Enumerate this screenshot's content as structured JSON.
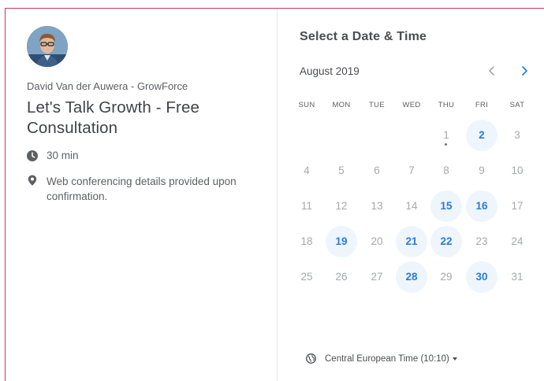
{
  "event": {
    "host": "David Van der Auwera - GrowForce",
    "title": "Let's Talk Growth - Free Consultation",
    "duration": "30 min",
    "location": "Web conferencing details provided upon confirmation."
  },
  "calendar": {
    "heading": "Select a Date & Time",
    "month_label": "August 2019",
    "weekdays": [
      "SUN",
      "MON",
      "TUE",
      "WED",
      "THU",
      "FRI",
      "SAT"
    ],
    "days": [
      {
        "d": "1",
        "available": false,
        "today": true
      },
      {
        "d": "2",
        "available": true
      },
      {
        "d": "3",
        "available": false
      },
      {
        "d": "4",
        "available": false
      },
      {
        "d": "5",
        "available": false
      },
      {
        "d": "6",
        "available": false
      },
      {
        "d": "7",
        "available": false
      },
      {
        "d": "8",
        "available": false
      },
      {
        "d": "9",
        "available": false
      },
      {
        "d": "10",
        "available": false
      },
      {
        "d": "11",
        "available": false
      },
      {
        "d": "12",
        "available": false
      },
      {
        "d": "13",
        "available": false
      },
      {
        "d": "14",
        "available": false
      },
      {
        "d": "15",
        "available": true
      },
      {
        "d": "16",
        "available": true
      },
      {
        "d": "17",
        "available": false
      },
      {
        "d": "18",
        "available": false
      },
      {
        "d": "19",
        "available": true
      },
      {
        "d": "20",
        "available": false
      },
      {
        "d": "21",
        "available": true
      },
      {
        "d": "22",
        "available": true
      },
      {
        "d": "23",
        "available": false
      },
      {
        "d": "24",
        "available": false
      },
      {
        "d": "25",
        "available": false
      },
      {
        "d": "26",
        "available": false
      },
      {
        "d": "27",
        "available": false
      },
      {
        "d": "28",
        "available": true
      },
      {
        "d": "29",
        "available": false
      },
      {
        "d": "30",
        "available": true
      },
      {
        "d": "31",
        "available": false
      }
    ],
    "first_weekday_index": 4,
    "timezone": "Central European Time (10:10)"
  },
  "colors": {
    "accent": "#2a7bd8",
    "available_bg": "#eef5fd",
    "frame_border": "#c43a62"
  }
}
